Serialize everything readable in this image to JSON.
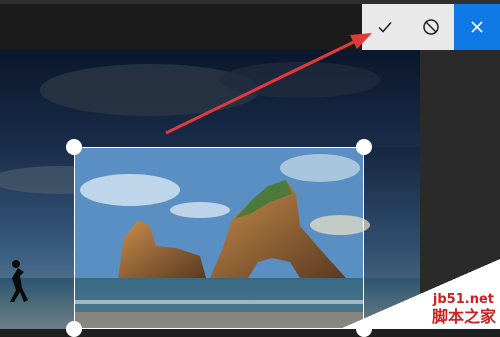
{
  "toolbar": {
    "buttons": [
      {
        "name": "accept-crop-button",
        "icon": "checkmark-icon"
      },
      {
        "name": "reset-crop-button",
        "icon": "circle-slash-icon"
      },
      {
        "name": "close-button",
        "icon": "close-icon"
      }
    ],
    "accent_color": "#0f7ae5"
  },
  "photo": {
    "subject": "sea-arch-rock-landscape-photo",
    "crop_handles": [
      "top-left",
      "top-right",
      "bottom-left",
      "bottom-right"
    ]
  },
  "annotation": {
    "arrow_color": "#e23a3a"
  },
  "watermark": {
    "site": "jb51.net",
    "name": "脚本之家"
  }
}
